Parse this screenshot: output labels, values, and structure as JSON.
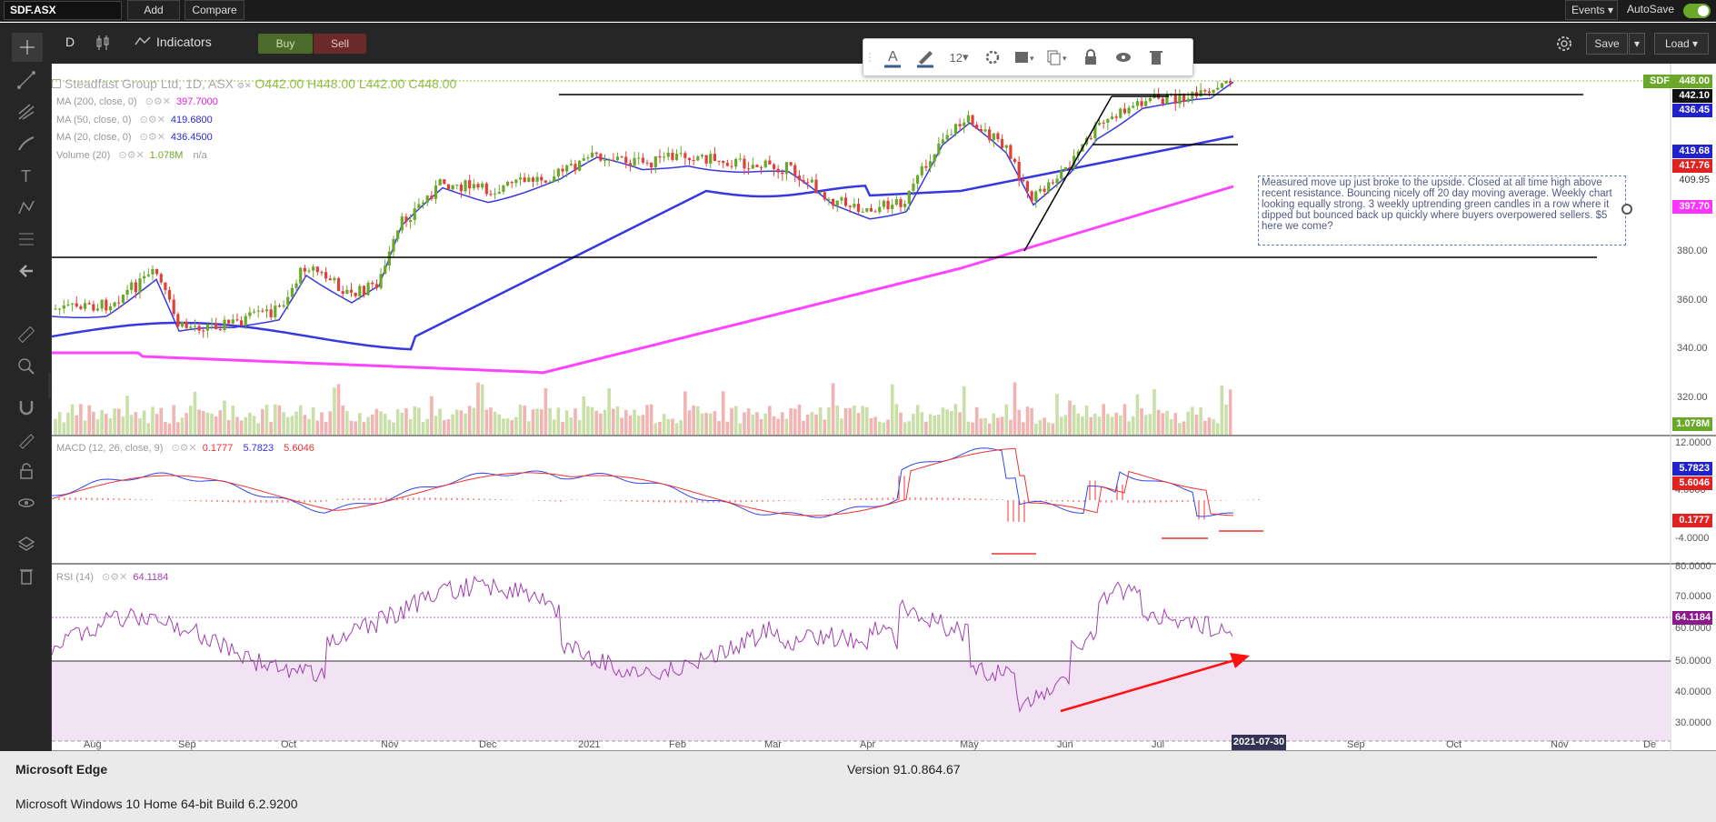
{
  "topbar": {
    "symbol": "SDF.ASX",
    "add": "Add",
    "compare": "Compare",
    "events": "Events",
    "autosave": "AutoSave"
  },
  "toolbar": {
    "period": "D",
    "indicators": "Indicators",
    "buy": "Buy",
    "sell": "Sell",
    "save": "Save",
    "load": "Load"
  },
  "drawbar": {
    "font_size": "12"
  },
  "legend": {
    "title": "Steadfast Group Ltd, 1D, ASX",
    "open": "O442.00",
    "high": "H448.00",
    "low": "L442.00",
    "close": "C448.00",
    "ma200": {
      "label": "MA (200, close, 0)",
      "value": "397.7000",
      "color": "#e020e0"
    },
    "ma50": {
      "label": "MA (50, close, 0)",
      "value": "419.6800",
      "color": "#2b2bd9"
    },
    "ma20": {
      "label": "MA (20, close, 0)",
      "value": "436.4500",
      "color": "#2b2bd9"
    },
    "volume": {
      "label": "Volume (20)",
      "value": "1.078M",
      "extra": "n/a"
    },
    "macd": {
      "label": "MACD (12, 26, close, 9)",
      "hist": "0.1777",
      "macd": "5.7823",
      "signal": "5.6046"
    },
    "rsi": {
      "label": "RSI (14)",
      "value": "64.1184"
    }
  },
  "annotation": "Measured move up just broke to the upside. Closed at all time high above recent resistance. Bouncing nicely off 20 day moving average. Weekly chart looking equally strong. 3 weekly uptrending green candles in a row where it dipped but bounced back up quickly where buyers overpowered sellers. $5 here we come?",
  "price_axis": {
    "ticks": [
      "380.00",
      "360.00",
      "340.00",
      "320.00"
    ],
    "labels": {
      "sdf": "SDF",
      "close": "448.00",
      "l1": "442.10",
      "l2": "436.45",
      "l3": "419.68",
      "l4": "417.76",
      "l5": "409.95",
      "l6": "397.70",
      "vol": "1.078M"
    }
  },
  "macd_axis": {
    "ticks": [
      "12.0000",
      "4.0000",
      "-4.0000"
    ],
    "labels": {
      "macd": "5.7823",
      "signal": "5.6046",
      "hist": "0.1777"
    }
  },
  "rsi_axis": {
    "ticks": [
      "80.0000",
      "70.0000",
      "60.0000",
      "50.0000",
      "40.0000",
      "30.0000"
    ],
    "labels": {
      "rsi": "64.1184"
    }
  },
  "time_axis": {
    "ticks": [
      "Aug",
      "Sep",
      "Oct",
      "Nov",
      "Dec",
      "2021",
      "Feb",
      "Mar",
      "Apr",
      "May",
      "Jun",
      "Jul",
      "Sep",
      "Oct",
      "Nov",
      "De"
    ],
    "current": "2021-07-30"
  },
  "status": {
    "browser": "Microsoft Edge",
    "version": "Version 91.0.864.67",
    "os": "Microsoft Windows 10 Home 64-bit Build 6.2.9200"
  },
  "colors": {
    "up": "#6aa82a",
    "down": "#e0403a",
    "ma_blue": "#3838e0",
    "ma_pink": "#ff44ff",
    "macd_line": "#3344ee",
    "signal_line": "#ee3333",
    "rsi_line": "#a040b0"
  }
}
